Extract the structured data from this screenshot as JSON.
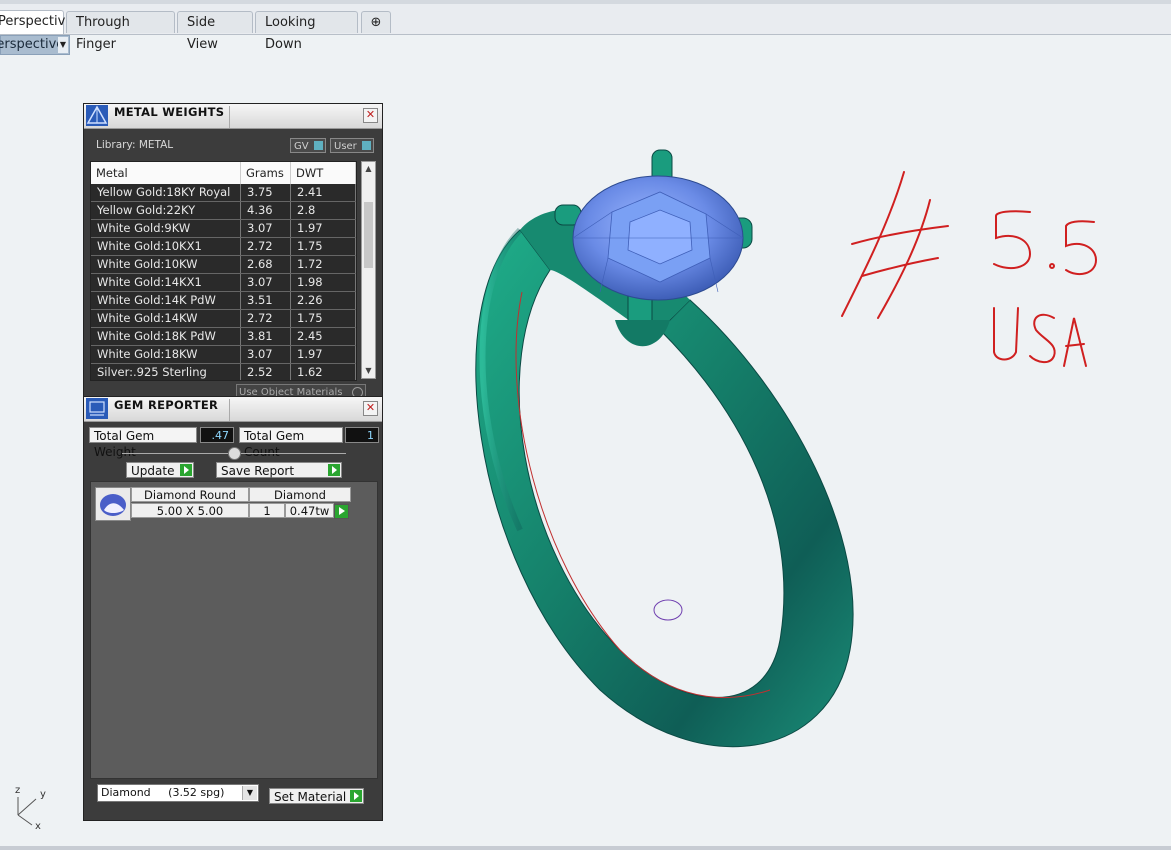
{
  "tabs": [
    {
      "label": "Perspective",
      "active": true
    },
    {
      "label": "Through Finger",
      "active": false
    },
    {
      "label": "Side View",
      "active": false
    },
    {
      "label": "Looking Down",
      "active": false
    }
  ],
  "add_tab_icon": "plus-icon",
  "viewport_menu": {
    "label": "Perspective"
  },
  "metal_weights": {
    "title": "METAL WEIGHTS",
    "library_label": "Library: METAL",
    "toggle_gv": "GV",
    "toggle_user": "User",
    "columns": [
      "Metal",
      "Grams",
      "DWT"
    ],
    "rows": [
      [
        "Yellow Gold:18KY Royal",
        "3.75",
        "2.41"
      ],
      [
        "Yellow Gold:22KY",
        "4.36",
        "2.8"
      ],
      [
        "White Gold:9KW",
        "3.07",
        "1.97"
      ],
      [
        "White Gold:10KX1",
        "2.72",
        "1.75"
      ],
      [
        "White Gold:10KW",
        "2.68",
        "1.72"
      ],
      [
        "White Gold:14KX1",
        "3.07",
        "1.98"
      ],
      [
        "White Gold:14K PdW",
        "3.51",
        "2.26"
      ],
      [
        "White Gold:14KW",
        "2.72",
        "1.75"
      ],
      [
        "White Gold:18K PdW",
        "3.81",
        "2.45"
      ],
      [
        "White Gold:18KW",
        "3.07",
        "1.97"
      ],
      [
        "Silver:.925 Sterling",
        "2.52",
        "1.62"
      ]
    ],
    "use_object_materials": "Use Object Materials"
  },
  "gem_reporter": {
    "title": "GEM REPORTER",
    "total_weight_label": "Total Gem Weight",
    "total_weight_value": ".47",
    "total_count_label": "Total Gem Count",
    "total_count_value": "1",
    "update_label": "Update",
    "save_report_label": "Save Report",
    "gem": {
      "shape": "Diamond Round",
      "material": "Diamond",
      "size": "5.00 X 5.00",
      "count": "1",
      "weight": "0.47tw"
    },
    "material_select": "Diamond     (3.52 spg)",
    "set_material_label": "Set Material"
  },
  "annotation": {
    "lines": [
      "# 5.5",
      "USA"
    ],
    "color": "#d02020"
  },
  "axes": {
    "z": "z",
    "y": "y",
    "x": "x"
  },
  "colors": {
    "ring": "#1a8a6e",
    "stone": "#6c8ee8",
    "panel_bg": "#3c3c3c",
    "accent_go": "#2aa530"
  }
}
